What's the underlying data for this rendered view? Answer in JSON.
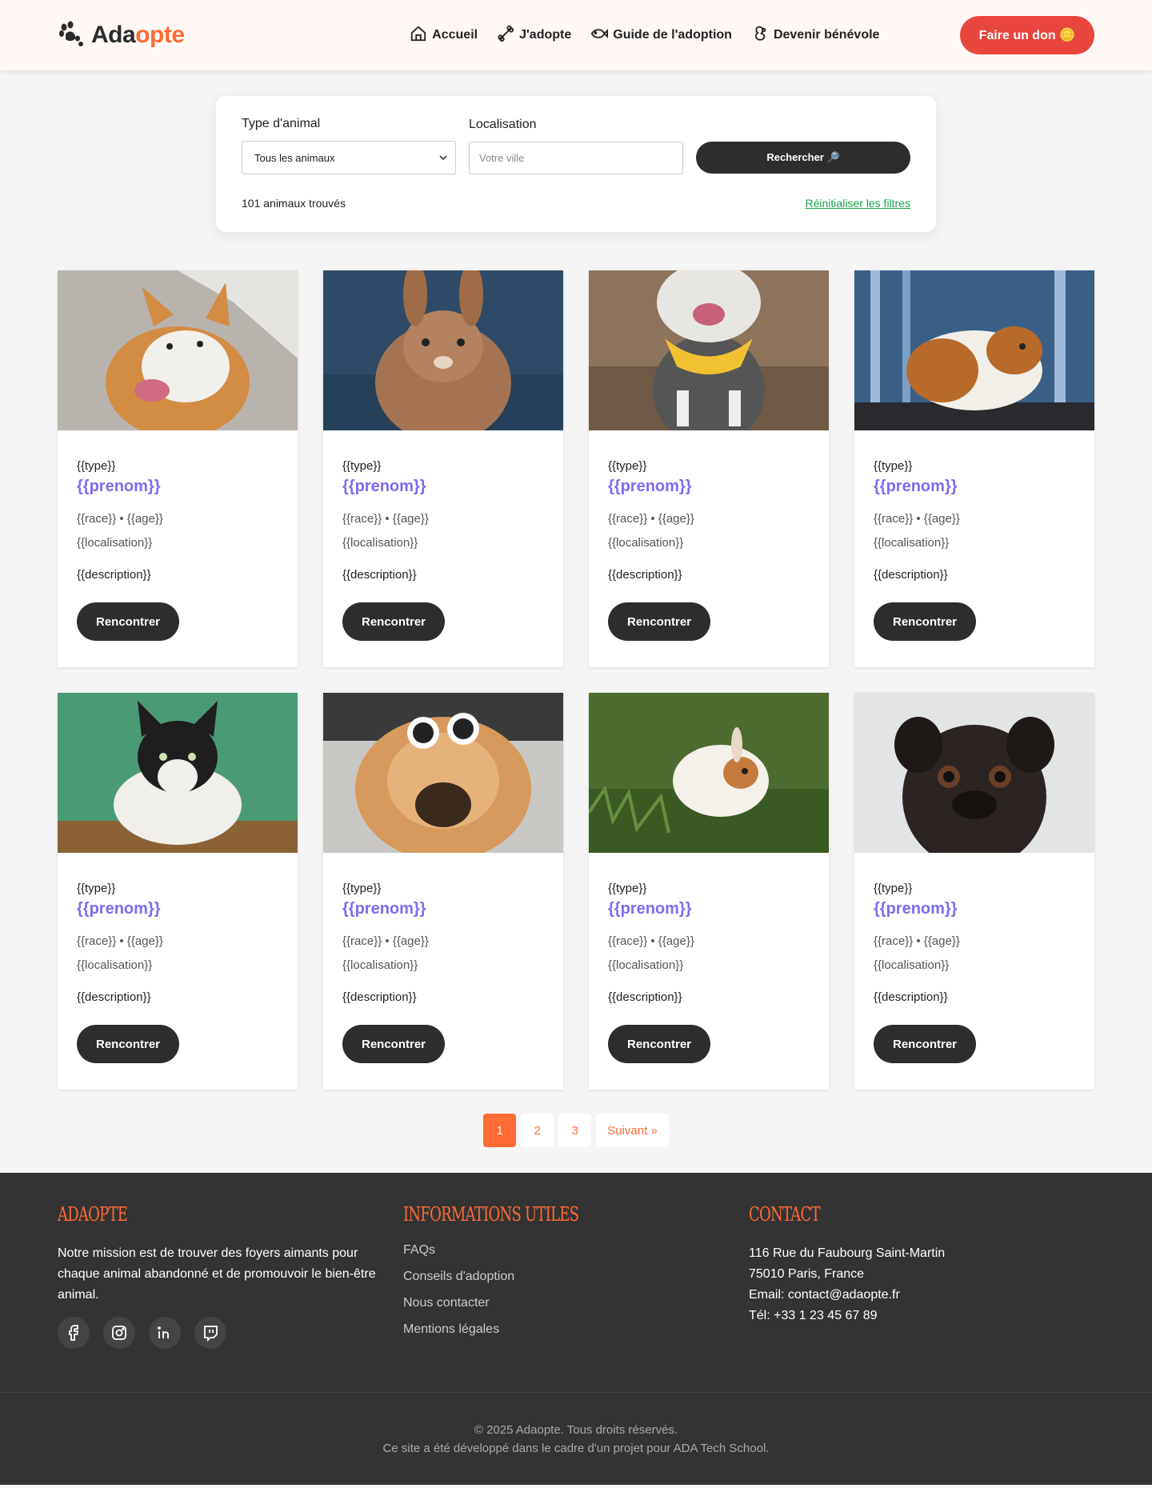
{
  "header": {
    "logo": {
      "part1": "Ada",
      "part2": "opte"
    },
    "nav": [
      {
        "label": "Accueil",
        "icon": "home-icon"
      },
      {
        "label": "J'adopte",
        "icon": "bone-icon"
      },
      {
        "label": "Guide de l'adoption",
        "icon": "fish-icon"
      },
      {
        "label": "Devenir bénévole",
        "icon": "squirrel-icon"
      }
    ],
    "donate": "Faire un don 🪙"
  },
  "search": {
    "type_label": "Type d'animal",
    "type_value": "Tous les animaux",
    "location_label": "Localisation",
    "location_placeholder": "Votre ville",
    "button": "Rechercher 🔎",
    "results": "101 animaux trouvés",
    "reset": "Réinitialiser les filtres"
  },
  "cards": [
    {
      "type": "{{type}}",
      "name": "{{prenom}}",
      "breed_age": "{{race}} • {{age}}",
      "location": "{{localisation}}",
      "description": "{{description}}",
      "button": "Rencontrer",
      "photo": "corgi"
    },
    {
      "type": "{{type}}",
      "name": "{{prenom}}",
      "breed_age": "{{race}} • {{age}}",
      "location": "{{localisation}}",
      "description": "{{description}}",
      "button": "Rencontrer",
      "photo": "rabbit"
    },
    {
      "type": "{{type}}",
      "name": "{{prenom}}",
      "breed_age": "{{race}} • {{age}}",
      "location": "{{localisation}}",
      "description": "{{description}}",
      "button": "Rencontrer",
      "photo": "cat-scarf"
    },
    {
      "type": "{{type}}",
      "name": "{{prenom}}",
      "breed_age": "{{race}} • {{age}}",
      "location": "{{localisation}}",
      "description": "{{description}}",
      "button": "Rencontrer",
      "photo": "guinea-pig"
    },
    {
      "type": "{{type}}",
      "name": "{{prenom}}",
      "breed_age": "{{race}} • {{age}}",
      "location": "{{localisation}}",
      "description": "{{description}}",
      "button": "Rencontrer",
      "photo": "cat-green"
    },
    {
      "type": "{{type}}",
      "name": "{{prenom}}",
      "breed_age": "{{race}} • {{age}}",
      "location": "{{localisation}}",
      "description": "{{description}}",
      "button": "Rencontrer",
      "photo": "dog-sunglasses"
    },
    {
      "type": "{{type}}",
      "name": "{{prenom}}",
      "breed_age": "{{race}} • {{age}}",
      "location": "{{localisation}}",
      "description": "{{description}}",
      "button": "Rencontrer",
      "photo": "bunny-grass"
    },
    {
      "type": "{{type}}",
      "name": "{{prenom}}",
      "breed_age": "{{race}} • {{age}}",
      "location": "{{localisation}}",
      "description": "{{description}}",
      "button": "Rencontrer",
      "photo": "pug"
    }
  ],
  "pagination": {
    "pages": [
      "1",
      "2",
      "3"
    ],
    "next": "Suivant »",
    "current": "1"
  },
  "footer": {
    "about_title": "Adaopte",
    "mission": "Notre mission est de trouver des foyers aimants pour chaque animal abandonné et de promouvoir le bien-être animal.",
    "info_title": "Informations utiles",
    "links": [
      "FAQs",
      "Conseils d'adoption",
      "Nous contacter",
      "Mentions légales"
    ],
    "contact_title": "Contact",
    "contact": [
      "116 Rue du Faubourg Saint-Martin",
      "75010 Paris, France",
      "Email: contact@adaopte.fr",
      "Tél: +33 1 23 45 67 89"
    ],
    "copyright": "© 2025 Adaopte. Tous droits réservés.",
    "credit": "Ce site a été développé dans le cadre d'un projet pour ADA Tech School."
  },
  "colors": {
    "accent": "#ff6b35",
    "donate": "#e8453c",
    "name": "#7b6cf0",
    "dark": "#2d2d2d",
    "link": "#18a34a"
  }
}
